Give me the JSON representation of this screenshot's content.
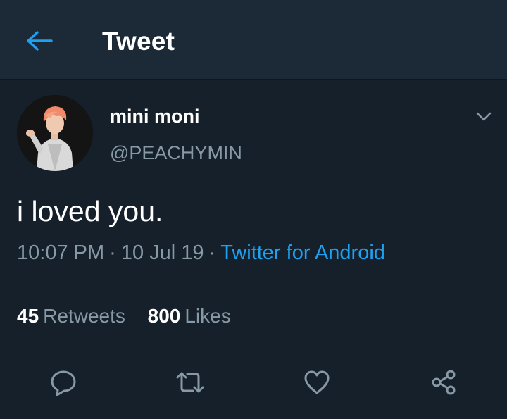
{
  "header": {
    "title": "Tweet",
    "back_icon": "arrow-left-icon"
  },
  "colors": {
    "background": "#15202b",
    "header_background": "#1c2a38",
    "accent": "#1da1f2",
    "secondary_text": "#8899a6",
    "divider": "#38444d"
  },
  "tweet": {
    "author": {
      "display_name": "mini moni",
      "handle": "@PEACHYMIN"
    },
    "text": "i loved you.",
    "time": "10:07 PM",
    "date": "10 Jul 19",
    "separator": "·",
    "source": "Twitter for Android",
    "stats": {
      "retweets_count": "45",
      "retweets_label": "Retweets",
      "likes_count": "800",
      "likes_label": "Likes"
    },
    "actions": [
      "reply-icon",
      "retweet-icon",
      "like-icon",
      "share-icon"
    ]
  }
}
